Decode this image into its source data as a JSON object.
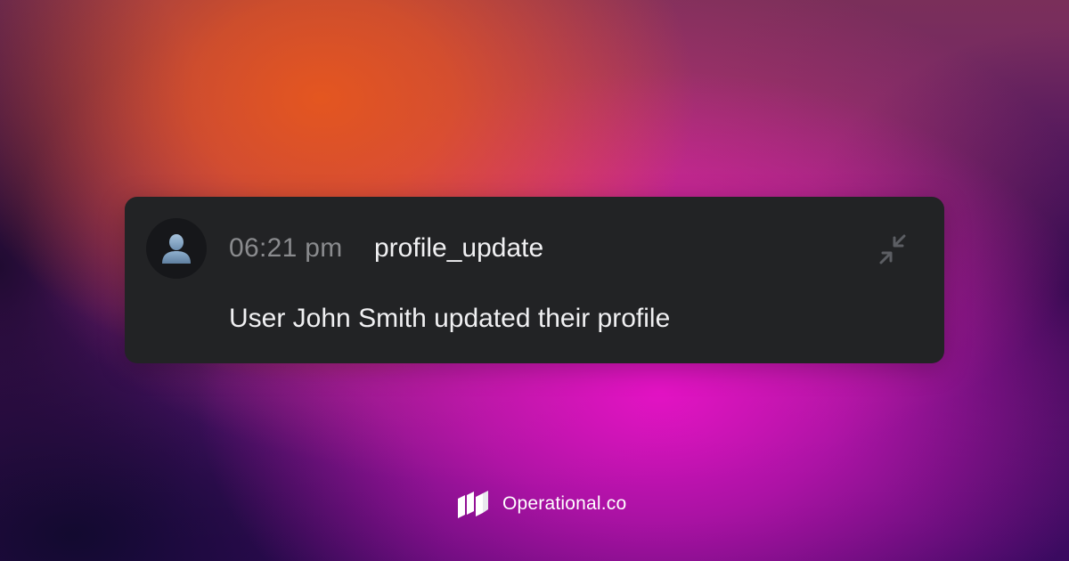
{
  "notification": {
    "time": "06:21 pm",
    "event": "profile_update",
    "message": "User John Smith updated their profile",
    "avatar_icon": "user-avatar-icon",
    "collapse_icon": "collapse-arrows-icon"
  },
  "brand": {
    "name": "Operational.co",
    "logo_icon": "operational-logo-icon"
  },
  "colors": {
    "card_background": "#222325",
    "time_text": "#8a8b8e",
    "primary_text": "#f0f0f2",
    "accent_orange": "#e8581c",
    "accent_magenta": "#e812c8"
  }
}
